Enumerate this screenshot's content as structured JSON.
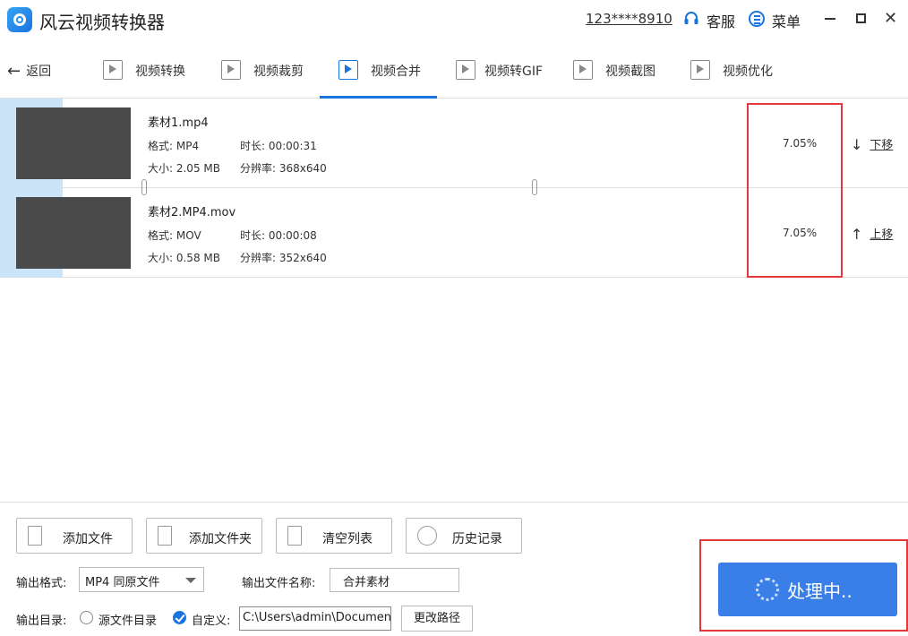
{
  "app": {
    "title": "风云视频转换器"
  },
  "header": {
    "user_id": "123****8910",
    "service_label": "客服",
    "menu_label": "菜单"
  },
  "nav": {
    "back_label": "返回",
    "tabs": [
      {
        "label": "视频转换",
        "icon": "video-convert-icon"
      },
      {
        "label": "视频裁剪",
        "icon": "video-crop-icon"
      },
      {
        "label": "视频合并",
        "icon": "video-merge-icon",
        "active": true
      },
      {
        "label": "视频转GIF",
        "icon": "gif-icon"
      },
      {
        "label": "视频截图",
        "icon": "screenshot-icon"
      },
      {
        "label": "视频优化",
        "icon": "optimize-icon"
      }
    ]
  },
  "files": [
    {
      "name": "素材1.mp4",
      "format_label": "格式: MP4",
      "duration_label": "时长: 00:00:31",
      "size_label": "大小: 2.05 MB",
      "resolution_label": "分辨率: 368x640",
      "progress": "7.05%",
      "move_label": "下移",
      "move_arrow": "↓"
    },
    {
      "name": "素材2.MP4.mov",
      "format_label": "格式: MOV",
      "duration_label": "时长: 00:00:08",
      "size_label": "大小: 0.58 MB",
      "resolution_label": "分辨率: 352x640",
      "progress": "7.05%",
      "move_label": "上移",
      "move_arrow": "↑"
    }
  ],
  "actions": {
    "add_file": "添加文件",
    "add_folder": "添加文件夹",
    "clear_list": "清空列表",
    "history": "历史记录"
  },
  "output": {
    "format_label": "输出格式:",
    "format_value": "MP4 同原文件",
    "name_label": "输出文件名称:",
    "name_value": "合并素材",
    "dir_label": "输出目录:",
    "source_dir_label": "源文件目录",
    "custom_label": "自定义:",
    "path_value": "C:\\Users\\admin\\Documents",
    "change_path_label": "更改路径"
  },
  "process": {
    "label": "处理中.."
  },
  "colors": {
    "accent": "#1a74e0",
    "button": "#3a7ee8",
    "highlight": "#e23a3a",
    "selection": "#cce4f7"
  }
}
